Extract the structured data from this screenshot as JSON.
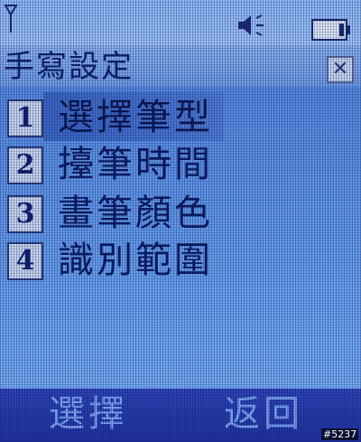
{
  "status_bar": {
    "icons": [
      "signal-icon",
      "speaker-icon",
      "battery-icon"
    ]
  },
  "header": {
    "title": "手寫設定",
    "close_icon": "close-icon"
  },
  "menu": {
    "selected_index": 0,
    "items": [
      {
        "number": "1",
        "label": "選擇筆型"
      },
      {
        "number": "2",
        "label": "擡筆時間"
      },
      {
        "number": "3",
        "label": "畫筆顏色"
      },
      {
        "number": "4",
        "label": "識別範圍"
      }
    ]
  },
  "softkeys": {
    "left": "選擇",
    "right": "返回"
  },
  "watermark": "#5237",
  "colors": {
    "accent": "#2e44b8",
    "highlight": "#3b66c4",
    "text": "#0b1a5e"
  }
}
